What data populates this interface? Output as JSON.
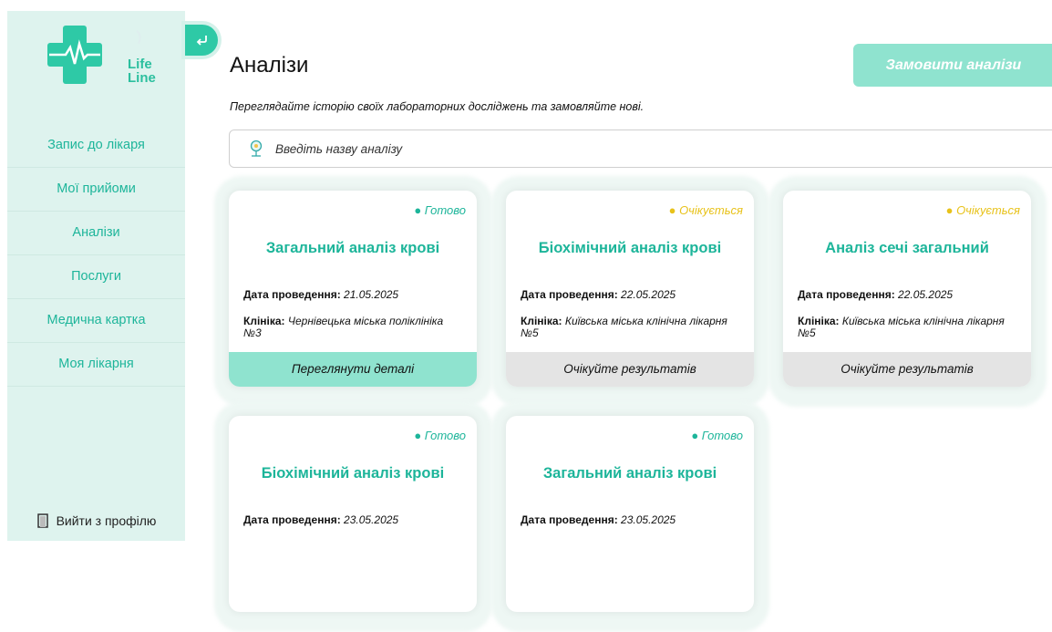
{
  "logo": {
    "line1": "Life",
    "line2": "Line"
  },
  "sidebar": {
    "items": [
      {
        "label": "Запис до лікаря"
      },
      {
        "label": "Мої прийоми"
      },
      {
        "label": "Аналізи"
      },
      {
        "label": "Послуги"
      },
      {
        "label": "Медична картка"
      },
      {
        "label": "Моя лікарня"
      }
    ],
    "logout": "Вийти з профілю"
  },
  "header": {
    "title": "Аналізи",
    "subtitle": "Переглядайте історію своїх лабораторних досліджень та замовляйте нові.",
    "order_button": "Замовити аналізи"
  },
  "search": {
    "placeholder": "Введіть назву аналізу"
  },
  "labels": {
    "date": "Дата проведення:",
    "clinic": "Клініка:"
  },
  "cards": [
    {
      "status": "● Готово",
      "title": "Загальний аналіз крові",
      "date": "21.05.2025",
      "clinic": "Чернівецька міська поліклініка №3",
      "button": "Переглянути деталі"
    },
    {
      "status": "● Очікується",
      "title": "Біохімічний аналіз крові",
      "date": "22.05.2025",
      "clinic": "Київська міська клінічна лікарня №5",
      "button": "Очікуйте результатів"
    },
    {
      "status": "● Очікується",
      "title": "Аналіз сечі загальний",
      "date": "22.05.2025",
      "clinic": "Київська міська клінічна лікарня №5",
      "button": "Очікуйте результатів"
    },
    {
      "status": "● Готово",
      "title": "Біохімічний аналіз крові",
      "date": "23.05.2025"
    },
    {
      "status": "● Готово",
      "title": "Загальний аналіз крові",
      "date": "23.05.2025"
    }
  ],
  "colors": {
    "accent": "#1db59a",
    "accent_light": "#8fe3cf",
    "waiting": "#e8c21a",
    "sidebar_bg": "#def3ee"
  }
}
